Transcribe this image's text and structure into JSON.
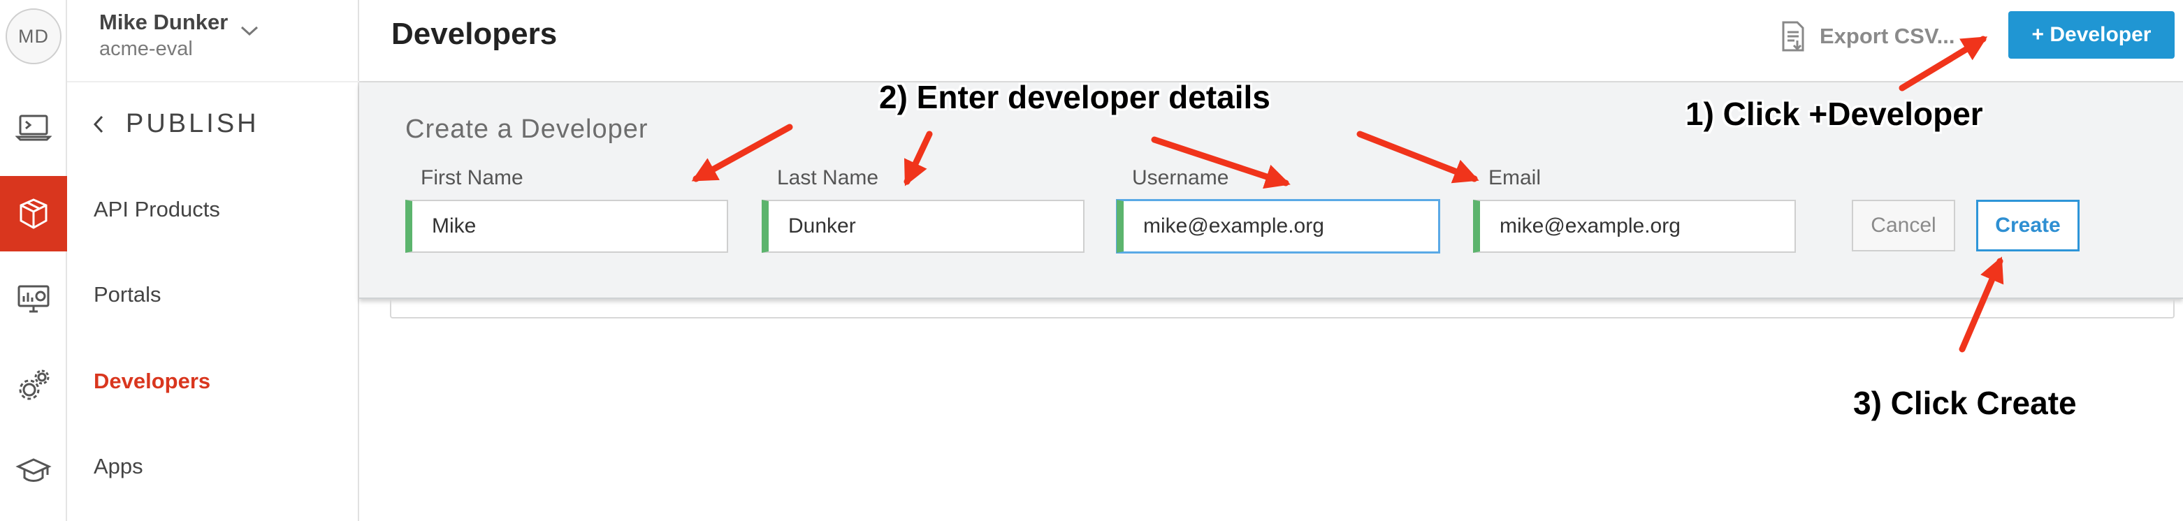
{
  "user": {
    "initials": "MD",
    "name": "Mike Dunker",
    "org": "acme-eval"
  },
  "nav": {
    "section": "PUBLISH",
    "items": [
      {
        "label": "API Products"
      },
      {
        "label": "Portals"
      },
      {
        "label": "Developers"
      },
      {
        "label": "Apps"
      }
    ]
  },
  "header": {
    "title": "Developers",
    "export_label": "Export CSV...",
    "add_developer_label": "+ Developer"
  },
  "form": {
    "title": "Create a Developer",
    "fields": [
      {
        "label": "First Name",
        "value": "Mike"
      },
      {
        "label": "Last Name",
        "value": "Dunker"
      },
      {
        "label": "Username",
        "value": "mike@example.org"
      },
      {
        "label": "Email",
        "value": "mike@example.org"
      }
    ],
    "cancel_label": "Cancel",
    "create_label": "Create"
  },
  "annotations": {
    "step1": "1) Click +Developer",
    "step2": "2) Enter developer details",
    "step3": "3) Click Create"
  },
  "colors": {
    "accent_red": "#d9361e",
    "primary_blue": "#2096d3",
    "valid_green": "#5cb46d",
    "arrow_red": "#f0341b"
  },
  "icons": [
    "terminal-icon",
    "package-icon",
    "dashboard-icon",
    "gears-icon",
    "graduation-cap-icon",
    "export-file-icon",
    "chevron-down-icon",
    "chevron-left-icon"
  ]
}
